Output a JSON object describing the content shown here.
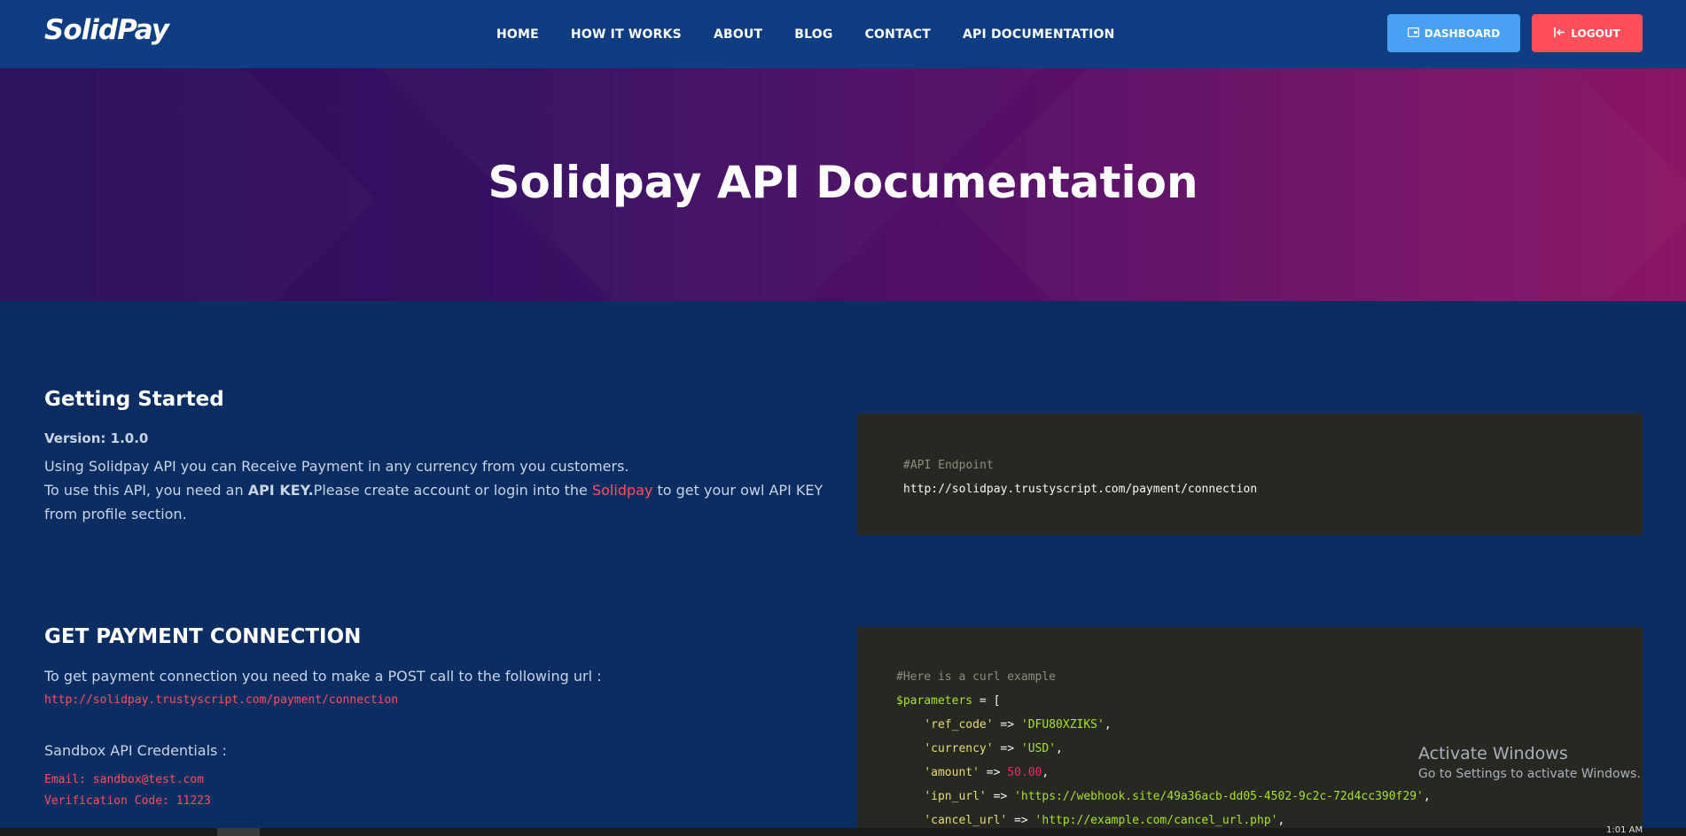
{
  "brand": {
    "logo": "SolidPay"
  },
  "nav": {
    "items": [
      "HOME",
      "HOW IT WORKS",
      "ABOUT",
      "BLOG",
      "CONTACT",
      "API DOCUMENTATION"
    ],
    "dashboard_label": "DASHBOARD",
    "logout_label": "LOGOUT"
  },
  "hero": {
    "title": "Solidpay API Documentation"
  },
  "getting_started": {
    "heading": "Getting Started",
    "version": "Version: 1.0.0",
    "p1": "Using Solidpay API you can Receive Payment in any currency from you customers.",
    "p2_a": "To use this API, you need an ",
    "p2_key": "API KEY.",
    "p2_b": "Please create account or login into the ",
    "p2_link": "Solidpay",
    "p2_c": " to get your owl API KEY from profile section."
  },
  "endpoint_code": {
    "comment": "#API Endpoint",
    "url": "http://solidpay.trustyscript.com/payment/connection"
  },
  "payment_connection": {
    "heading": "GET PAYMENT CONNECTION",
    "p1": "To get payment connection you need to make a POST call to the following url :",
    "url": "http://solidpay.trustyscript.com/payment/connection",
    "sandbox_label": "Sandbox API Credentials :",
    "email": "Email: sandbox@test.com",
    "verification": "Verification Code: 11223"
  },
  "curl_code": {
    "comment": "#Here is a curl example",
    "line1_var": "$parameters",
    "line1_rest": " = [",
    "params": [
      {
        "key": "'ref_code'",
        "value": "'DFU80XZIKS'",
        "type": "str"
      },
      {
        "key": "'currency'",
        "value": "'USD'",
        "type": "str"
      },
      {
        "key": "'amount'",
        "value": "50.00",
        "type": "num"
      },
      {
        "key": "'ipn_url'",
        "value": "'https://webhook.site/49a36acb-dd05-4502-9c2c-72d4cc390f29'",
        "type": "str"
      },
      {
        "key": "'cancel_url'",
        "value": "'http://example.com/cancel_url.php'",
        "type": "str"
      }
    ]
  },
  "windows_watermark": {
    "title": "Activate Windows",
    "subtitle": "Go to Settings to activate Windows."
  },
  "taskbar": {
    "clock": "1:01 AM"
  },
  "colors": {
    "nav_bg": "#0f3d82",
    "page_bg": "#0b2d61",
    "dashboard_btn": "#4aa1f3",
    "logout_btn": "#ff4f5a",
    "code_bg": "#272822"
  }
}
